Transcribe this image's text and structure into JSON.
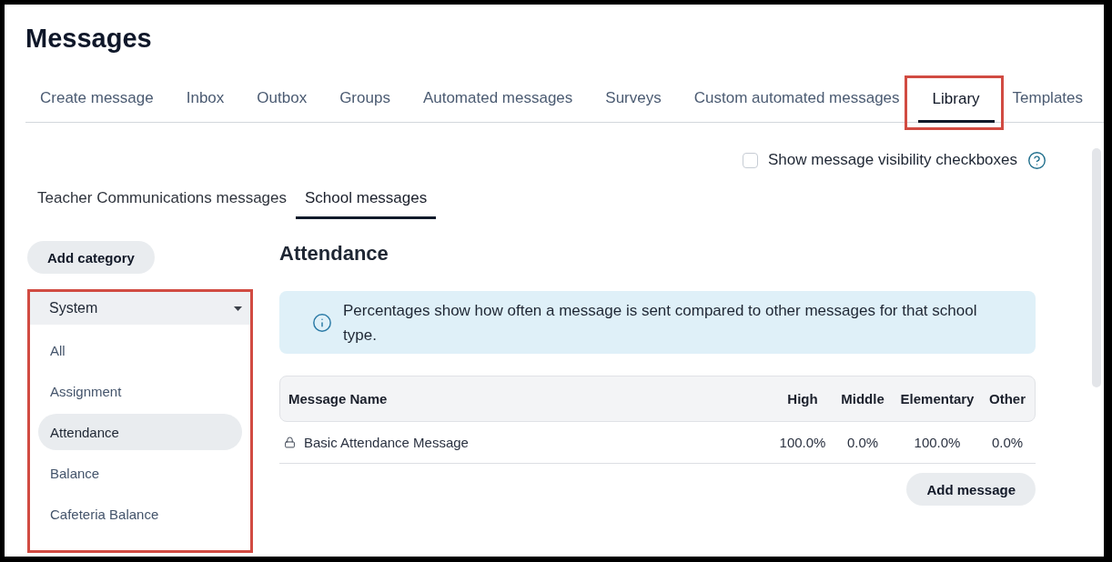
{
  "page": {
    "title": "Messages"
  },
  "tabs": [
    {
      "label": "Create message",
      "selected": false,
      "highlighted": false
    },
    {
      "label": "Inbox",
      "selected": false,
      "highlighted": false
    },
    {
      "label": "Outbox",
      "selected": false,
      "highlighted": false
    },
    {
      "label": "Groups",
      "selected": false,
      "highlighted": false
    },
    {
      "label": "Automated messages",
      "selected": false,
      "highlighted": false
    },
    {
      "label": "Surveys",
      "selected": false,
      "highlighted": false
    },
    {
      "label": "Custom automated messages",
      "selected": false,
      "highlighted": false
    },
    {
      "label": "Library",
      "selected": true,
      "highlighted": true
    },
    {
      "label": "Templates",
      "selected": false,
      "highlighted": false
    }
  ],
  "visibility_option": {
    "label": "Show message visibility checkboxes",
    "checked": false
  },
  "sub_tabs": [
    {
      "label": "Teacher Communications messages",
      "selected": false
    },
    {
      "label": "School messages",
      "selected": true
    }
  ],
  "sidebar": {
    "add_button": "Add category",
    "category_dropdown": {
      "value": "System",
      "highlighted": true,
      "items": [
        {
          "label": "All",
          "selected": false
        },
        {
          "label": "Assignment",
          "selected": false
        },
        {
          "label": "Attendance",
          "selected": true
        },
        {
          "label": "Balance",
          "selected": false
        },
        {
          "label": "Cafeteria Balance",
          "selected": false
        }
      ]
    }
  },
  "content": {
    "heading": "Attendance",
    "info": "Percentages show how often a message is sent compared to other messages for that school type.",
    "table": {
      "columns": [
        "Message Name",
        "High",
        "Middle",
        "Elementary",
        "Other"
      ],
      "rows": [
        {
          "locked": true,
          "cells": [
            "Basic Attendance Message",
            "100.0%",
            "0.0%",
            "100.0%",
            "0.0%"
          ]
        }
      ]
    },
    "add_button": "Add message"
  }
}
